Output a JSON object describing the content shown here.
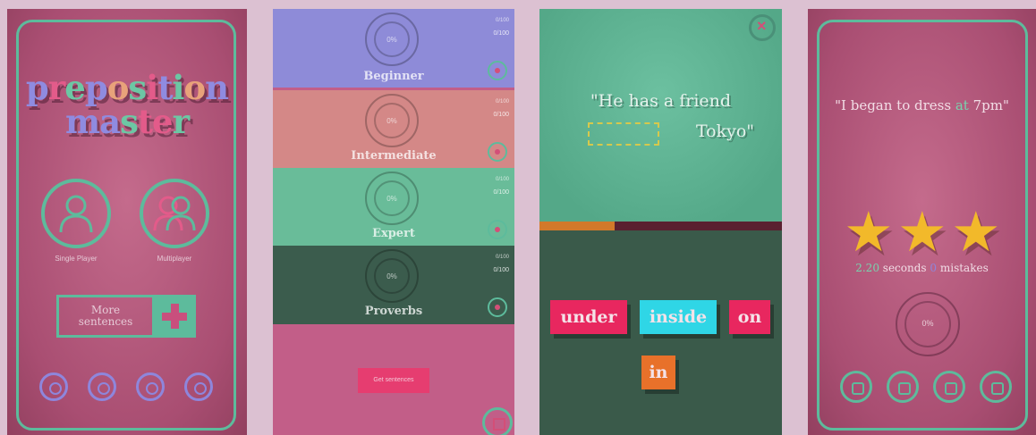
{
  "panel1": {
    "logo_line1": [
      "p",
      "r",
      "e",
      "p",
      "o",
      "s",
      "i",
      "t",
      "i",
      "o",
      "n"
    ],
    "logo_line1_colors": [
      "#8f8be0",
      "#e35b8a",
      "#6cc7a4",
      "#8f8be0",
      "#e8a27a",
      "#6cc7a4",
      "#e35b8a",
      "#8f8be0",
      "#6cc7a4",
      "#e8a27a",
      "#8f8be0"
    ],
    "logo_line2": [
      "m",
      "a",
      "s",
      "t",
      "e",
      "r"
    ],
    "logo_line2_colors": [
      "#8f8be0",
      "#8f8be0",
      "#6cc7a4",
      "#e35b8a",
      "#e35b8a",
      "#6cc7a4"
    ],
    "single_label": "Single Player",
    "multi_label": "Multiplayer",
    "more_line1": "More",
    "more_line2": "sentences",
    "accent": "#5dbb9c"
  },
  "panel2": {
    "levels": [
      {
        "name": "Beginner",
        "pct": "0%",
        "score": "0/100",
        "lock": "0/100"
      },
      {
        "name": "Intermediate",
        "pct": "0%",
        "score": "0/100",
        "lock": "0/100"
      },
      {
        "name": "Expert",
        "pct": "0%",
        "score": "0/100",
        "lock": "0/100"
      },
      {
        "name": "Proverbs",
        "pct": "0%",
        "score": "0/100",
        "lock": "0/100"
      }
    ],
    "bottom_button": "Get sentences"
  },
  "panel3": {
    "question_line1": "\"He has a friend",
    "question_line2": "Tokyo\"",
    "progress": 0.31,
    "answers": [
      {
        "text": "under",
        "color": "#e8275f"
      },
      {
        "text": "inside",
        "color": "#2fd6e6"
      },
      {
        "text": "on",
        "color": "#e8275f"
      },
      {
        "text": "in",
        "color": "#e8712a"
      }
    ]
  },
  "panel4": {
    "sentence_prefix": "\"I began to dress",
    "sentence_highlight": "at",
    "sentence_suffix": "7pm\"",
    "stats_seconds_value": "2.20",
    "stats_seconds_label": "seconds",
    "stats_mistakes_value": "0",
    "stats_mistakes_label": "mistakes",
    "score": "0%",
    "stars": 3
  }
}
